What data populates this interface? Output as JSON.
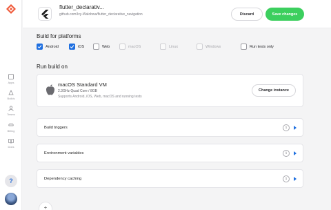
{
  "sidebar": {
    "items": [
      {
        "label": "Apps",
        "icon": "apps-icon"
      },
      {
        "label": "Builds",
        "icon": "builds-icon"
      },
      {
        "label": "Teams",
        "icon": "teams-icon"
      },
      {
        "label": "Billing",
        "icon": "billing-icon"
      },
      {
        "label": "Docs",
        "icon": "docs-icon"
      }
    ],
    "help_label": "?"
  },
  "header": {
    "app_title": "flutter_declarativ...",
    "repo": "github.com/Ivy-Walobwa/flutter_declarative_navigation",
    "discard_label": "Discard",
    "save_label": "Save changes"
  },
  "build_for": {
    "title": "Build for platforms",
    "platforms": [
      {
        "label": "Android",
        "checked": true,
        "enabled": true
      },
      {
        "label": "iOS",
        "checked": true,
        "enabled": true
      },
      {
        "label": "Web",
        "checked": false,
        "enabled": true
      },
      {
        "label": "macOS",
        "checked": false,
        "enabled": false
      },
      {
        "label": "Linux",
        "checked": false,
        "enabled": false
      },
      {
        "label": "Windows",
        "checked": false,
        "enabled": false
      },
      {
        "label": "Run tests only",
        "checked": false,
        "enabled": true
      }
    ]
  },
  "run_on": {
    "title": "Run build on",
    "vm_name": "macOS Standard VM",
    "vm_spec": "2.3GHz Quad Core / 8GB",
    "vm_support": "Supports Android, iOS, Web, macOS and running tests",
    "change_label": "Change instance"
  },
  "sections": [
    {
      "label": "Build triggers"
    },
    {
      "label": "Environment variables"
    },
    {
      "label": "Dependency caching"
    }
  ],
  "colors": {
    "accent": "#1e6fe0",
    "save": "#3ccf5e"
  }
}
